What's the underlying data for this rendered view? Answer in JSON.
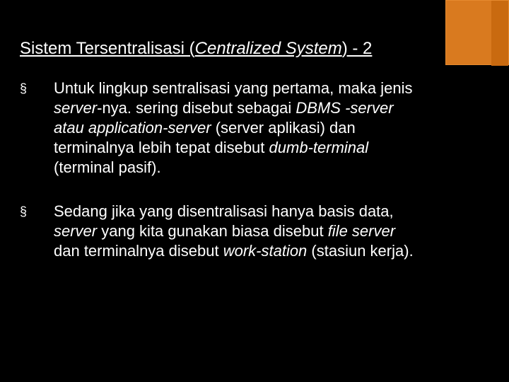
{
  "accent_color": "#d97a1f",
  "title": {
    "plain_prefix": "Sistem Tersentralisasi (",
    "italic": "Centralized System",
    "plain_suffix": ") - 2"
  },
  "bullets": [
    {
      "segments": [
        {
          "t": "Untuk lingkup sentralisasi yang pertama, maka jenis ",
          "i": false
        },
        {
          "t": "server",
          "i": true
        },
        {
          "t": "-nya. sering disebut sebagai ",
          "i": false
        },
        {
          "t": "DBMS -server atau application-server ",
          "i": true
        },
        {
          "t": " (server aplikasi) dan terminalnya lebih tepat disebut ",
          "i": false
        },
        {
          "t": "dumb-terminal ",
          "i": true
        },
        {
          "t": " (terminal pasif).",
          "i": false
        }
      ]
    },
    {
      "segments": [
        {
          "t": "Sedang jika yang disentralisasi hanya basis data, ",
          "i": false
        },
        {
          "t": "server",
          "i": true
        },
        {
          "t": " yang kita gunakan biasa disebut ",
          "i": false
        },
        {
          "t": "file server",
          "i": true
        },
        {
          "t": " dan terminalnya disebut ",
          "i": false
        },
        {
          "t": "work-station",
          "i": true
        },
        {
          "t": " (stasiun kerja).",
          "i": false
        }
      ]
    }
  ],
  "bullet_marker": "§"
}
